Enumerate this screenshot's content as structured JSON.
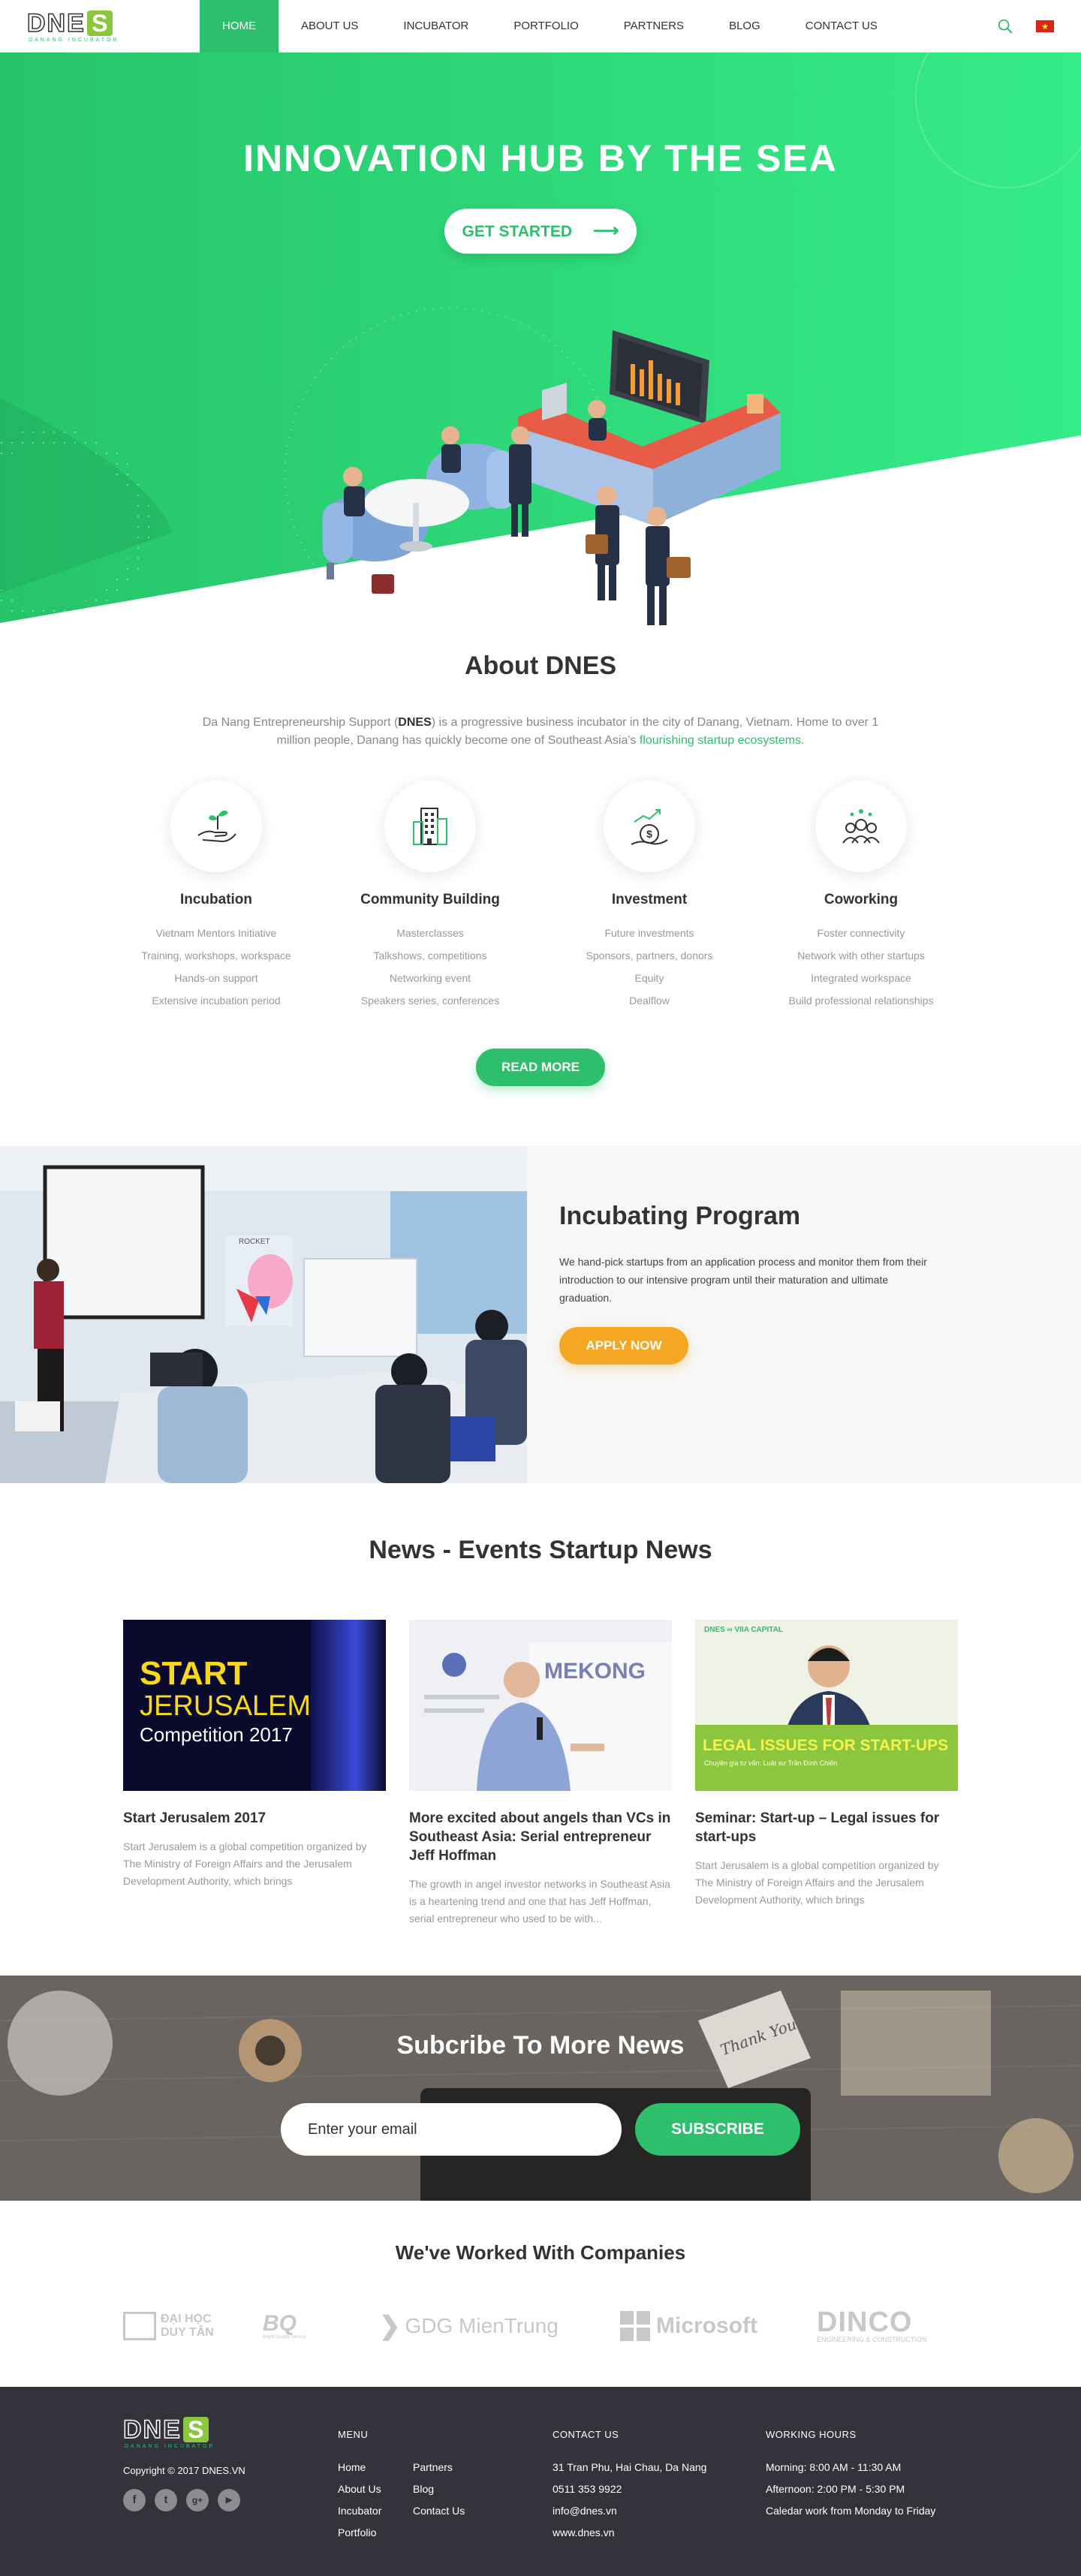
{
  "header": {
    "logo_text": "DNE",
    "logo_s": "S",
    "logo_tagline": "DANANG INCUBATOR",
    "nav": [
      {
        "label": "HOME",
        "active": true
      },
      {
        "label": "ABOUT US"
      },
      {
        "label": "INCUBATOR"
      },
      {
        "label": "PORTFOLIO"
      },
      {
        "label": "PARTNERS"
      },
      {
        "label": "BLOG"
      },
      {
        "label": "CONTACT US"
      }
    ],
    "flag_star": "★"
  },
  "hero": {
    "title": "INNOVATION HUB BY THE SEA",
    "cta_label": "GET STARTED",
    "cta_arrow": "⟶"
  },
  "about": {
    "title": "About DNES",
    "text_1": "Da Nang Entrepreneurship Support (",
    "text_brand": "DNES",
    "text_2": ") is a progressive business incubator in the city of Danang, Vietnam. Home to over 1 million people, Danang has quickly become one of Southeast Asia's ",
    "text_link": "flourishing startup ecosystems",
    "text_end": ".",
    "features": [
      {
        "icon": "hand-plant-icon",
        "title": "Incubation",
        "items": [
          "Vietnam Mentors Initiative",
          "Training, workshops, workspace",
          "Hands-on support",
          "Extensive incubation period"
        ]
      },
      {
        "icon": "buildings-icon",
        "title": "Community Building",
        "items": [
          "Masterclasses",
          "Talkshows, competitions",
          "Networking event",
          "Speakers series, conferences"
        ]
      },
      {
        "icon": "money-growth-icon",
        "title": "Investment",
        "items": [
          "Future investments",
          "Sponsors, partners, donors",
          "Equity",
          "Dealflow"
        ]
      },
      {
        "icon": "people-group-icon",
        "title": "Coworking",
        "items": [
          "Foster connectivity",
          "Network with other startups",
          "Integrated workspace",
          "Build professional relationships"
        ]
      }
    ],
    "read_more": "READ MORE"
  },
  "incubating": {
    "title": "Incubating Program",
    "text": "We hand-pick startups from an application process and monitor them from their introduction to our intensive program until their maturation and ultimate graduation.",
    "apply": "APPLY NOW",
    "photo_slide_brand": "ROCKET"
  },
  "news": {
    "title": "News - Events Startup News",
    "cards": [
      {
        "title": "Start Jerusalem 2017",
        "desc": "Start Jerusalem is a global competition organized by The Ministry of Foreign Affairs and the Jerusalem Development Authority, which brings",
        "img_line1": "START",
        "img_line2": "JERUSALEM",
        "img_line3": "Competition 2017"
      },
      {
        "title": "More excited about angels than VCs in Southeast Asia: Serial entrepreneur Jeff Hoffman",
        "desc": "The growth in angel investor networks in Southeast Asia is a heartening trend and one that has Jeff Hoffman, serial entrepreneur who used to be with...",
        "img_banner": "MEKONG"
      },
      {
        "title": "Seminar: Start-up – Legal issues for start-ups",
        "desc": "Start Jerusalem is a global competition organized by The Ministry of Foreign Affairs and the Jerusalem Development Authority, which brings",
        "img_logo": "DNES ∞ VIIA CAPITAL",
        "img_banner": "LEGAL ISSUES FOR START-UPS",
        "img_sub": "Chuyên gia tư vấn: Luật sư Trần Đình Chiến"
      }
    ]
  },
  "subscribe": {
    "title": "Subcribe To More News",
    "placeholder": "Enter your email",
    "button": "SUBSCRIBE",
    "card_text": "Thank You"
  },
  "partners": {
    "title": "We've Worked With Companies",
    "logos": [
      {
        "name": "DAI HOC DUY TAN",
        "line1": "ĐẠI HỌC",
        "line2": "DUY TÂN"
      },
      {
        "name": "BQ",
        "line1": "BQ",
        "line2": "Bright Quality Service"
      },
      {
        "name": "GDG MienTrung",
        "line1": "GDG MienTrung"
      },
      {
        "name": "Microsoft",
        "line1": "Microsoft"
      },
      {
        "name": "DINCO",
        "line1": "DINCO",
        "line2": "ENGINEERING & CONSTRUCTION"
      }
    ]
  },
  "footer": {
    "copyright": "Copyright © 2017 DNES.VN",
    "menu_head": "MENU",
    "menu_col1": [
      "Home",
      "About Us",
      "Incubator",
      "Portfolio"
    ],
    "menu_col2": [
      "Partners",
      "Blog",
      "Contact Us"
    ],
    "contact_head": "CONTACT US",
    "contact": [
      "31 Tran Phu, Hai Chau, Da Nang",
      "0511 353 9922",
      "info@dnes.vn",
      "www.dnes.vn"
    ],
    "hours_head": "WORKING HOURS",
    "hours": [
      "Morning: 8:00 AM - 11:30 AM",
      "Afternoon: 2:00 PM - 5:30 PM",
      "Caledar work from Monday to Friday"
    ],
    "social": [
      "f",
      "t",
      "g+",
      "▶"
    ]
  },
  "colors": {
    "green": "#2dbf6c",
    "orange": "#f5a623",
    "dark": "#33343b",
    "logo_green": "#8cc63f"
  }
}
